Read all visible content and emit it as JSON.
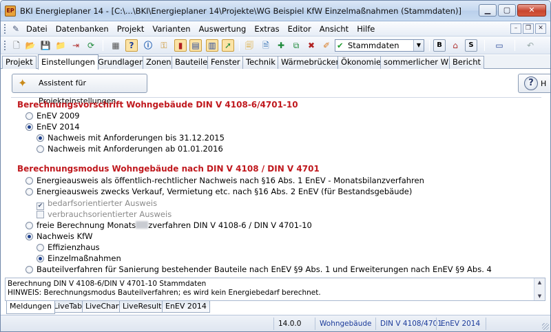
{
  "window": {
    "title": "BKI Energieplaner 14 - [C:\\...\\BKI\\Energieplaner 14\\Projekte\\WG Beispiel KfW Einzelmaßnahmen (Stammdaten)]",
    "app_icon_text": "EP"
  },
  "menu": {
    "items": [
      "Datei",
      "Datenbanken",
      "Projekt",
      "Varianten",
      "Auswertung",
      "Extras",
      "Editor",
      "Ansicht",
      "Hilfe"
    ]
  },
  "toolbar": {
    "select_value": "Stammdaten",
    "letter_buttons": [
      "B",
      "S"
    ]
  },
  "tabs": [
    "Projekt",
    "Einstellungen",
    "Grundlagen",
    "Zonen",
    "Bauteile",
    "Fenster",
    "Technik",
    "Wärmebrücken",
    "Ökonomie",
    "sommerlicher WS",
    "Bericht"
  ],
  "content": {
    "assistant_label": "Assistent für Projekteinstellungen",
    "help_label": "H",
    "section1_title": "Berechnungsvorschrift Wohngebäude DIN V 4108-6/4701-10",
    "section1_options": {
      "enev2009": "EnEV 2009",
      "enev2014": "EnEV 2014",
      "req2015": "Nachweis mit Anforderungen bis 31.12.2015",
      "req2016": "Nachweis mit Anforderungen ab 01.01.2016"
    },
    "section2_title": "Berechnungsmodus Wohngebäude nach DIN V 4108 / DIN V 4701",
    "section2_options": {
      "opt1": "Energieausweis als öffentlich-rechtlicher Nachweis nach §16 Abs. 1 EnEV - Monatsbilanzverfahren",
      "opt2": "Energieausweis zwecks Verkauf, Vermietung etc. nach §16 Abs. 2 EnEV (für Bestandsgebäude)",
      "chk1": "bedarfsorientierter Ausweis",
      "chk2": "verbrauchsorientierter Ausweis",
      "opt3_a": "freie Berechnung Monats",
      "opt3_b": "zverfahren DIN V 4108-6 / DIN V 4701-10",
      "opt4": "Nachweis KfW",
      "opt4a": "Effizienzhaus",
      "opt4b": "Einzelmaßnahmen",
      "opt5": "Bauteilverfahren für Sanierung bestehender Bauteile nach EnEV §9 Abs. 1 und Erweiterungen nach EnEV §9 Abs. 4"
    }
  },
  "messages": {
    "line1": "Berechnung DIN V 4108-6/DIN V 4701-10 Stammdaten",
    "line2": "HINWEIS: Berechnungsmodus Bauteilverfahren; es wird kein Energiebedarf berechnet."
  },
  "bottom_tabs": [
    "Meldungen",
    "LiveTab",
    "LiveChart",
    "LiveResults",
    "EnEV 2014"
  ],
  "status": {
    "version": "14.0.0",
    "building": "Wohngebäude",
    "norm": "DIN V 4108/4701",
    "enev": "EnEV 2014"
  }
}
